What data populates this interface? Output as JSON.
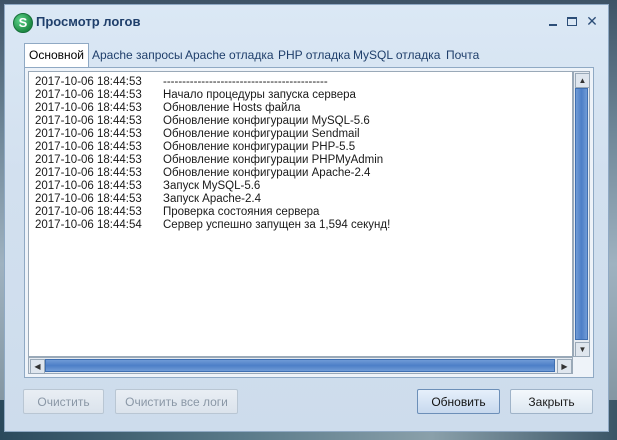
{
  "window": {
    "title": "Просмотр логов",
    "app_icon_letter": "S"
  },
  "tabs": [
    {
      "label": "Основной",
      "active": true
    },
    {
      "label": "Apache запросы",
      "active": false
    },
    {
      "label": "Apache отладка",
      "active": false
    },
    {
      "label": "PHP отладка",
      "active": false
    },
    {
      "label": "MySQL отладка",
      "active": false
    },
    {
      "label": "Почта",
      "active": false
    }
  ],
  "log": [
    {
      "time": "2017-10-06 18:44:53",
      "message": "-------------------------------------------"
    },
    {
      "time": "2017-10-06 18:44:53",
      "message": "Начало процедуры запуска сервера"
    },
    {
      "time": "2017-10-06 18:44:53",
      "message": "Обновление Hosts файла"
    },
    {
      "time": "2017-10-06 18:44:53",
      "message": "Обновление конфигурации MySQL-5.6"
    },
    {
      "time": "2017-10-06 18:44:53",
      "message": "Обновление конфигурации Sendmail"
    },
    {
      "time": "2017-10-06 18:44:53",
      "message": "Обновление конфигурации PHP-5.5"
    },
    {
      "time": "2017-10-06 18:44:53",
      "message": "Обновление конфигурации PHPMyAdmin"
    },
    {
      "time": "2017-10-06 18:44:53",
      "message": "Обновление конфигурации Apache-2.4"
    },
    {
      "time": "2017-10-06 18:44:53",
      "message": "Запуск MySQL-5.6"
    },
    {
      "time": "2017-10-06 18:44:53",
      "message": "Запуск Apache-2.4"
    },
    {
      "time": "2017-10-06 18:44:53",
      "message": "Проверка состояния сервера"
    },
    {
      "time": "2017-10-06 18:44:54",
      "message": "Сервер успешно запущен за 1,594 секунд!"
    }
  ],
  "buttons": {
    "clear": "Очистить",
    "clear_all": "Очистить все логи",
    "refresh": "Обновить",
    "close": "Закрыть"
  }
}
